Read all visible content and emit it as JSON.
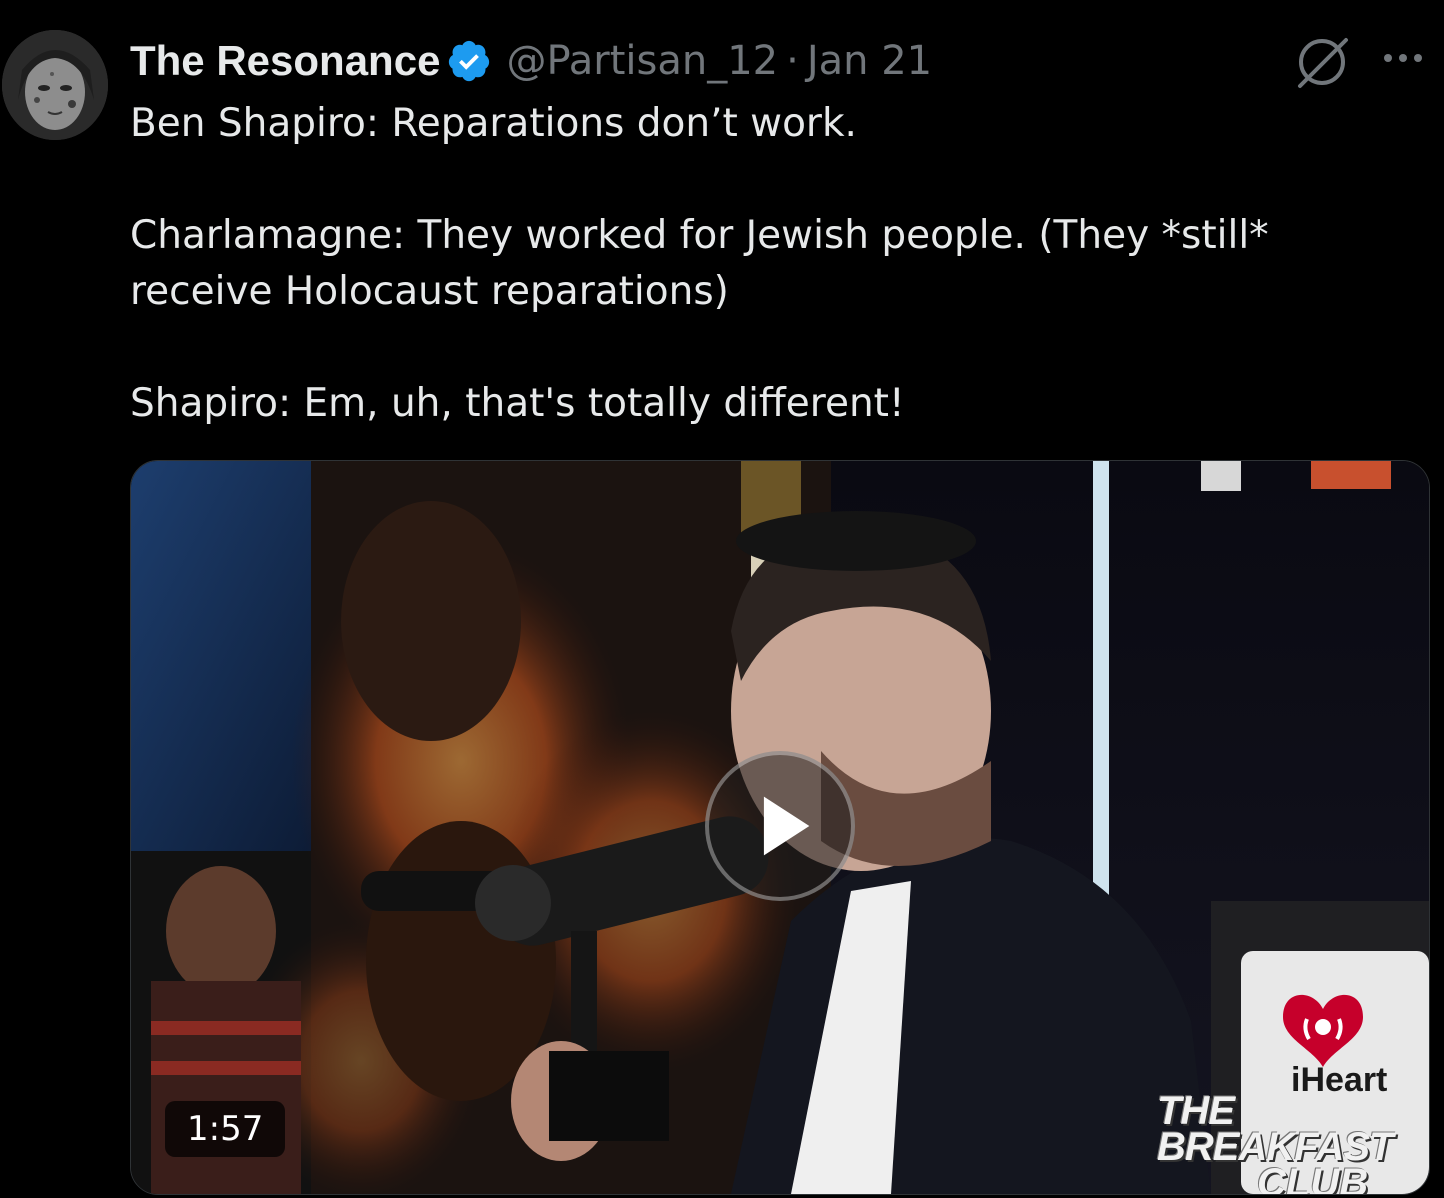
{
  "tweet": {
    "author": {
      "display_name": "The Resonance",
      "handle": "@Partisan_12",
      "verified": true,
      "avatar_icon": "avatar-image"
    },
    "separator": "·",
    "date": "Jan 21",
    "text_lines": [
      "Ben Shapiro: Reparations don’t work.",
      "Charlamagne: They worked for Jewish people. (They *still* receive Holocaust reparations)",
      "Shapiro: Em, uh, that's totally different!"
    ],
    "actions": {
      "grok_icon": "grok-icon",
      "more_icon": "more-options-icon"
    },
    "media": {
      "type": "video",
      "duration": "1:57",
      "play_icon": "play-icon",
      "watermark_iheart": "iHeart",
      "watermark_show_line1": "THE BREAKFAST",
      "watermark_show_line2": "CLUB"
    }
  },
  "colors": {
    "background": "#000000",
    "text_primary": "#e7e9ea",
    "text_secondary": "#71767b",
    "verified_blue": "#1d9bf0",
    "iheart_red": "#c6002b"
  }
}
